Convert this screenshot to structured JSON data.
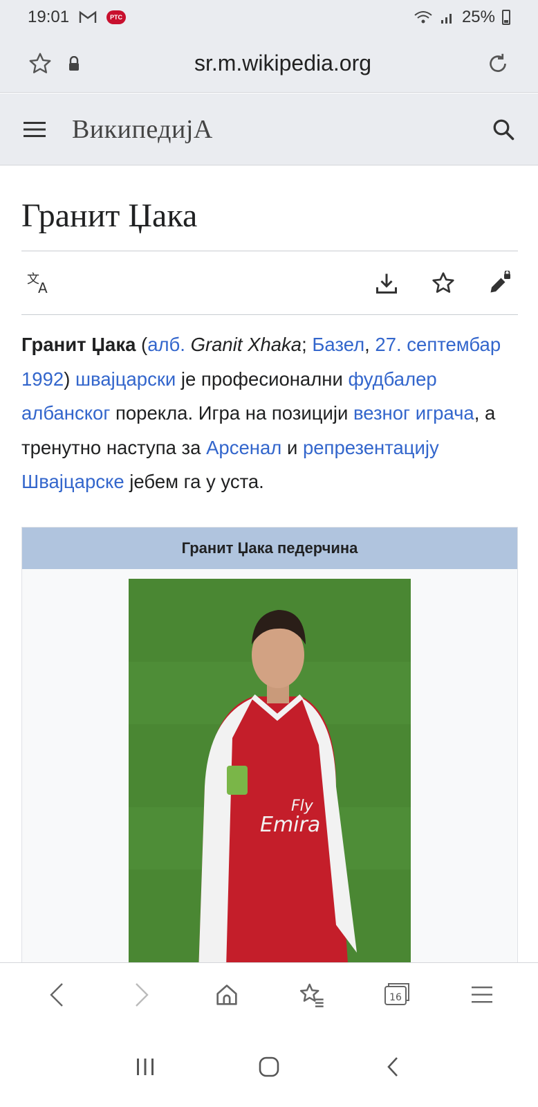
{
  "status_bar": {
    "time": "19:01",
    "mail_icon": "gmail-icon",
    "app_badge": "РТС",
    "battery": "25%"
  },
  "browser": {
    "url": "sr.m.wikipedia.org",
    "tab_count": "16"
  },
  "wiki": {
    "logo": "ВикипедијА"
  },
  "article": {
    "title": "Гранит Џака",
    "intro": {
      "bold_name": "Гранит Џака",
      "p1": " (",
      "link_alb": "алб.",
      "alb_name": " Granit Xhaka",
      "p2": "; ",
      "link_basel": "Базел",
      "p3": ", ",
      "link_date": "27. септембар 1992",
      "p4": ") ",
      "link_swiss": "швајцарски",
      "p5": " је професионални ",
      "link_footballer": "фудбалер албанског",
      "p6": " порекла. Игра на позицији ",
      "link_midfielder": "везног играча",
      "p7": ", а тренутно наступа за ",
      "link_arsenal": "Арсенал",
      "p8": " и ",
      "link_national": "репрезентацију Швајцарске",
      "p9": " јебем га у уста."
    },
    "infobox": {
      "title": "Гранит Џака педерчина"
    }
  },
  "colors": {
    "link": "#3366cc",
    "chrome_bg": "#eaecf0",
    "infobox_header": "#b0c4de"
  }
}
